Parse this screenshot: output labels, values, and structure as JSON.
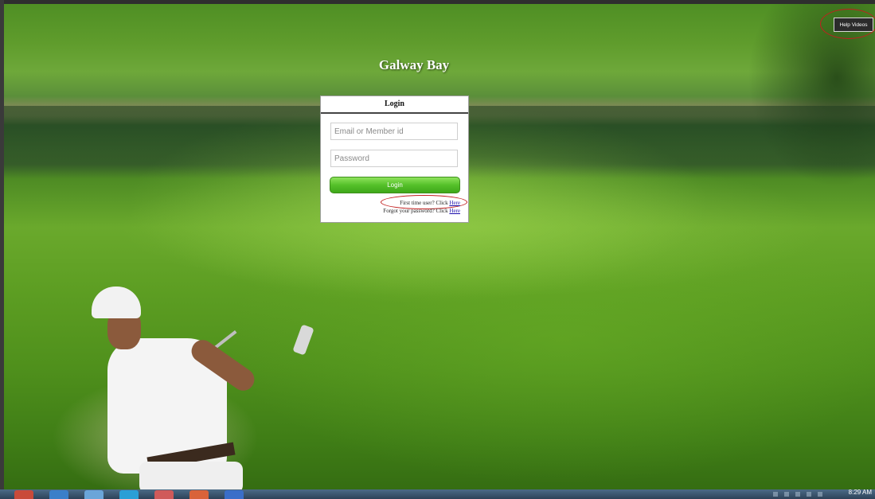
{
  "site": {
    "title": "Galway Bay"
  },
  "help": {
    "label": "Help Videos"
  },
  "login": {
    "header": "Login",
    "email_placeholder": "Email or Member id",
    "password_placeholder": "Password",
    "button_label": "Login",
    "first_time_text": "First time user? Click ",
    "first_time_link": "Here",
    "forgot_text": "Forgot your password? Click ",
    "forgot_link": "Here"
  },
  "taskbar": {
    "icons": [
      "chrome-icon",
      "outlook-icon",
      "browser-icon",
      "skype-icon",
      "paint-icon",
      "office-icon",
      "word-icon"
    ],
    "clock": "8:29 AM"
  },
  "colors": {
    "annotation": "#c21f1f",
    "button_green": "#55c02a",
    "link": "#1a0dab"
  }
}
